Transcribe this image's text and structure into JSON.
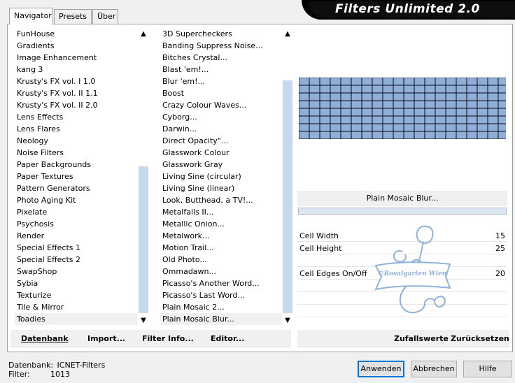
{
  "tabs": [
    {
      "label": "Navigator",
      "active": true
    },
    {
      "label": "Presets",
      "active": false
    },
    {
      "label": "Über",
      "active": false
    }
  ],
  "app_title": "Filters Unlimited 2.0",
  "categories": [
    "FunHouse",
    "Gradients",
    "Image Enhancement",
    "kang 3",
    "Krusty's FX vol. I 1.0",
    "Krusty's FX vol. II 1.1",
    "Krusty's FX vol. II 2.0",
    "Lens Effects",
    "Lens Flares",
    "Neology",
    "Noise Filters",
    "Paper Backgrounds",
    "Paper Textures",
    "Pattern Generators",
    "Photo Aging Kit",
    "Pixelate",
    "Psychosis",
    "Render",
    "Special Effects 1",
    "Special Effects 2",
    "SwapShop",
    "Sybia",
    "Texturize",
    "Tile & Mirror",
    "Toadies"
  ],
  "selected_category": "Toadies",
  "filters": [
    "3D Supercheckers",
    "Banding Suppress Noise...",
    "Bitches Crystal...",
    "Blast 'em!...",
    "Blur 'em!...",
    "Boost",
    "Crazy Colour Waves...",
    "Cyborg...",
    "Darwin...",
    "Direct Opacity\"...",
    "Glasswork Colour",
    "Glasswork Gray",
    "Living Sine (circular)",
    "Living Sine (linear)",
    "Look, Butthead, a TV!...",
    "Metalfalls II...",
    "Metallic Onion...",
    "Metalwork...",
    "Motion Trail...",
    "Old Photo...",
    "Ommadawn...",
    "Picasso's Another Word...",
    "Picasso's Last Word...",
    "Plain Mosaic 2...",
    "Plain Mosaic Blur..."
  ],
  "selected_filter": "Plain Mosaic Blur...",
  "toolbar_left": {
    "database": "Datenbank",
    "import": "Import...",
    "filter_info": "Filter Info...",
    "editor": "Editor..."
  },
  "toolbar_right": {
    "random": "Zufallswerte",
    "reset": "Zurücksetzen"
  },
  "preview_filter_name": "Plain Mosaic Blur...",
  "params": [
    {
      "label": "Cell Width",
      "value": "15"
    },
    {
      "label": "Cell Height",
      "value": "25"
    },
    {
      "label": "",
      "value": ""
    },
    {
      "label": "Cell Edges On/Off",
      "value": "20"
    }
  ],
  "watermark_text": "©Rosalgarten Wien",
  "status": {
    "database_label": "Datenbank:",
    "database_value": "ICNET-Filters",
    "filter_label": "Filter:",
    "filter_value": "1013"
  },
  "buttons": {
    "apply": "Anwenden",
    "cancel": "Abbrechen",
    "help": "Hilfe"
  },
  "colors": {
    "mosaic_fill": "#8fafd8",
    "scroll_thumb": "#c5d8ee",
    "accent": "#0078d7"
  }
}
